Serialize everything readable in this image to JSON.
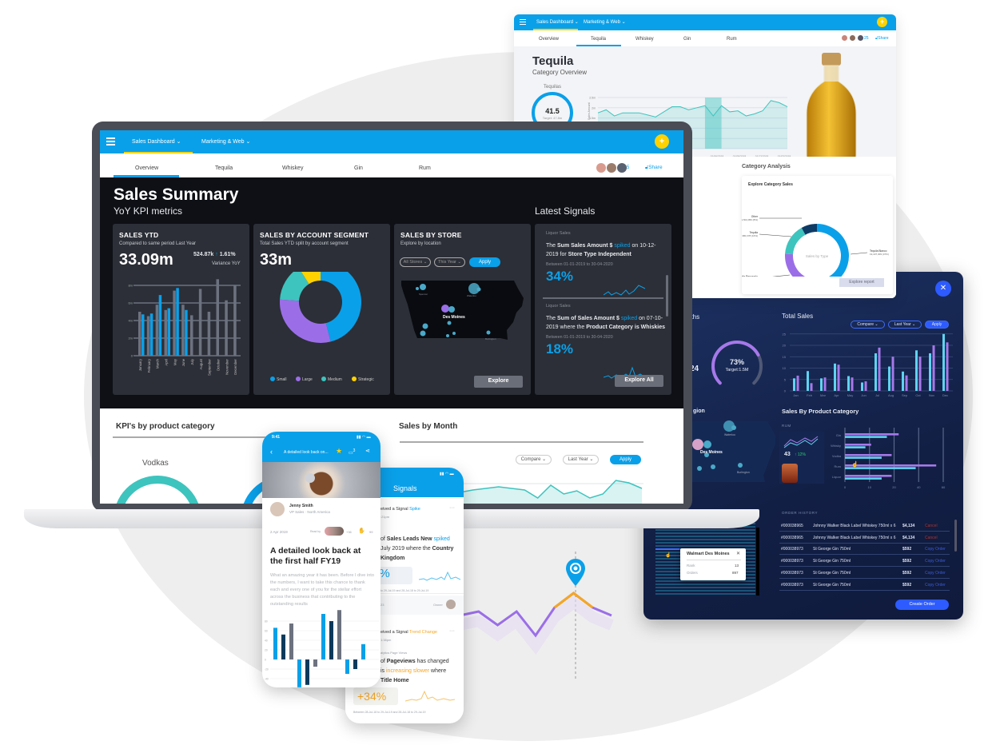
{
  "colors": {
    "brand_blue": "#0aa0e9",
    "accent_yellow": "#ffd200",
    "purple": "#9b6ee8",
    "teal": "#3dc4be",
    "navy_panel": "#16264f",
    "dark_screen": "#0e1016",
    "card_dark": "#2c2f37",
    "orange": "#f5a623",
    "apply_blue": "#2d5bff"
  },
  "tequila_window": {
    "nav": {
      "primary": "Sales Dashboard",
      "secondary": "Marketing & Web",
      "add_icon": "plus-icon",
      "menu_icon": "hamburger-icon"
    },
    "tabs": [
      "Overview",
      "Tequila",
      "Whiskey",
      "Gin",
      "Rum"
    ],
    "active_tab": "Tequila",
    "avatar_extra": "25",
    "share": "Share",
    "title": "Tequila",
    "subtitle": "Category Overview",
    "gauge": {
      "label": "Tequilas",
      "value": "41.5",
      "target": "Target: 47.8m"
    },
    "analysis_title": "Category Analysis",
    "analysis_card_title": "Explore Category Sales",
    "explore_button": "Explore report"
  },
  "dark_panel": {
    "close_icon": "close-icon",
    "partial_months": "nths",
    "partial_value": "24",
    "gauge": {
      "value": "73%",
      "target": "Target:1.5M",
      "fraction": 0.73
    },
    "partial_region": "gion",
    "map_cities": [
      "Waterloo",
      "Des Moines",
      "Burlington"
    ],
    "total_sales_title": "Total Sales",
    "compare": "Compare",
    "last_year": "Last Year",
    "apply": "Apply",
    "product_category_title": "Sales By Product Category",
    "rum_card": {
      "label": "RUM",
      "value": "43",
      "change": "12%"
    },
    "order_history_title": "ORDER HISTORY",
    "orders": [
      {
        "id": "#000038965",
        "item": "Johnny Walker Black Label Whiskey 750ml x 6",
        "amount": "$4,134",
        "action": "Cancel"
      },
      {
        "id": "#000038965",
        "item": "Johnny Walker Black Label Whiskey 750ml x 6",
        "amount": "$4,134",
        "action": "Cancel"
      },
      {
        "id": "#000038973",
        "item": "St George Gin 750ml",
        "amount": "$592",
        "action": "Copy Order"
      },
      {
        "id": "#000038973",
        "item": "St George Gin 750ml",
        "amount": "$592",
        "action": "Copy Order"
      },
      {
        "id": "#000038973",
        "item": "St George Gin 750ml",
        "amount": "$592",
        "action": "Copy Order"
      },
      {
        "id": "#000038973",
        "item": "St George Gin 750ml",
        "amount": "$592",
        "action": "Copy Order"
      }
    ],
    "create_order": "Create Order",
    "tooltip": {
      "title": "Walmart Des Moines",
      "rank_label": "Rank",
      "rank": "13",
      "orders_label": "Orders",
      "orders": "897"
    }
  },
  "laptop": {
    "nav": {
      "primary": "Sales Dashboard",
      "secondary": "Marketing & Web"
    },
    "tabs": [
      "Overview",
      "Tequila",
      "Whiskey",
      "Gin",
      "Rum"
    ],
    "active_tab": "Overview",
    "avatar_extra": "5",
    "share": "Share",
    "title": "Sales Summary",
    "subtitle": "YoY KPI metrics",
    "signals_title": "Latest Signals",
    "sales_ytd": {
      "title": "SALES YTD",
      "subtitle": "Compared to same period Last Year",
      "value": "33.09m",
      "variance": "524.87k",
      "variance_pct": "1.61%",
      "variance_label": "Variance YoY"
    },
    "segment": {
      "title": "SALES BY ACCOUNT SEGMENT",
      "subtitle": "Total Sales YTD split by account segment",
      "value": "33m"
    },
    "store": {
      "title": "SALES BY STORE",
      "subtitle": "Explore by location",
      "all_stores": "All Stores",
      "this_year": "This Year",
      "apply": "Apply",
      "cities": [
        "Spencer",
        "Waterloo",
        "Des Moines",
        "Burlington"
      ],
      "explore": "Explore"
    },
    "signals": [
      {
        "category": "Liquor Sales",
        "pre": "The ",
        "b1": "Sum Sales Amount $",
        "hl": " spiked",
        "mid": " on 10-12-2019 for ",
        "b2": "Store Type Independent",
        "range": "Between  01-01-2019 to 30-04-2020",
        "value": "34%"
      },
      {
        "category": "Liquor Sales",
        "pre": "The ",
        "b1": "Sum of Sales Amount $",
        "hl": " spiked",
        "mid": " on 07-10-2019 where the ",
        "b2": "Product Category is Whiskies",
        "range": "Between  01-01-2019 to 30-04-2020",
        "value": "18%"
      }
    ],
    "explore_all": "Explore All",
    "kpi_title": "KPI's by product category",
    "kpi_item": "Vodkas",
    "month_title": "Sales by Month",
    "compare": "Compare",
    "last_year": "Last Year",
    "apply": "Apply"
  },
  "phone_article": {
    "time": "9:41",
    "header_title": "A detailed look back on...",
    "comments": "3",
    "author": "Jenny Smith",
    "author_role": "VP Sales · North America",
    "date": "2 Apr 2019",
    "read_by": "Read by",
    "readers_extra": "+36",
    "claps": "99",
    "title": "A detailed look back at the first half FY19",
    "body": "What an amazing year it has been. Before I dive into the numbers, I want to take this chance to thank each and every one of you for the stellar effort across the business that contributing to the outstanding results"
  },
  "phone_signals": {
    "title": "Signals",
    "s1": {
      "head": "eived a Signal ",
      "type": "Spike",
      "time": ":21pm",
      "l1a": "of ",
      "l1b": "Sales Leads New",
      "l1c": " spiked",
      "l2a": "July 2019 where the ",
      "l2b": "Country",
      "l3": "Kingdom",
      "value": "3%",
      "range": "to 29-Jul-19 and 28-Jul-18 to 29-Jul-19",
      "footer_left": "23",
      "owner": "Owner"
    },
    "s2": {
      "head": "eived a Signal ",
      "type": "Trend Change",
      "time": "1:38pm",
      "category": "alytics Page Views",
      "l1a": "of ",
      "l1b": "Pageviews",
      "l1c": " has changed",
      "l2a": "is ",
      "l2b": "increasing slower",
      "l2c": " where",
      "l3": "Title Home",
      "value": "+34%",
      "range": "Between 28-Jul-18 to 29-Jul-19 and 28-Jul-18 to 29-Jul-19"
    }
  },
  "chart_data": [
    {
      "id": "sales_ytd",
      "type": "bar",
      "categories": [
        "January",
        "February",
        "March",
        "April",
        "May",
        "June",
        "July",
        "August",
        "September",
        "October",
        "November",
        "December"
      ],
      "yticks": [
        "0",
        "2m",
        "4m",
        "6m",
        "8m"
      ],
      "ylim": [
        0,
        9
      ],
      "grid": true,
      "series": [
        {
          "color": "#6d7280",
          "values": [
            5.0,
            4.5,
            5.8,
            5.2,
            7.4,
            5.8,
            4.6,
            7.6,
            5.0,
            8.7,
            6.3,
            8.0
          ]
        },
        {
          "color": "#0aa0e9",
          "values": [
            4.7,
            4.8,
            6.9,
            5.4,
            7.7,
            5.2,
            null,
            null,
            null,
            null,
            null,
            null
          ]
        }
      ]
    },
    {
      "id": "segment",
      "type": "pie",
      "labels": [
        "Small",
        "Large",
        "Medium",
        "Strategic"
      ],
      "values": [
        46,
        30,
        15,
        9
      ],
      "colors": [
        "#0aa0e9",
        "#9b6ee8",
        "#3dc4be",
        "#ffd200"
      ],
      "legend": "bottom"
    },
    {
      "id": "tequila_trend",
      "type": "area",
      "ylabel": "Sales Amount",
      "yticks": [
        "1m",
        "1.5m",
        "2m",
        "2.5m"
      ],
      "ylim": [
        0,
        2.5
      ],
      "xticks": [
        "01/06/2018",
        "01/09/2018",
        "01/12/2018",
        "01/03/2019"
      ],
      "values": [
        1.75,
        1.9,
        1.6,
        1.75,
        1.75,
        1.75,
        1.65,
        1.55,
        1.8,
        2.05,
        2.05,
        1.9,
        2.0,
        2.1,
        1.6,
        2.1,
        1.8,
        1.85,
        1.6,
        1.7,
        1.85,
        2.35,
        2.25,
        2.05
      ],
      "highlight": [
        13,
        15
      ],
      "color": "#3dc4be"
    },
    {
      "id": "category_sales",
      "type": "pie",
      "center_label": "Sales by Type",
      "labels": [
        "Tequila Blanco",
        "Tequila Reposado",
        "Tequila",
        "Other"
      ],
      "label_values": [
        "19,437,309 (47%)",
        "12,459,063 (29%)",
        "6,380,378 (16%)",
        "1,504,956 (8%)"
      ],
      "values": [
        47,
        29,
        16,
        8
      ],
      "colors": [
        "#0aa0e9",
        "#9b6ee8",
        "#3dc4be",
        "#0d3b66"
      ]
    },
    {
      "id": "total_sales",
      "type": "bar",
      "categories": [
        "Jan",
        "Feb",
        "Mar",
        "Apr",
        "May",
        "Jun",
        "Jul",
        "Aug",
        "Sep",
        "Oct",
        "Nov",
        "Dec"
      ],
      "yticks": [
        "0",
        "5",
        "10",
        "15",
        "20",
        "25"
      ],
      "ylim": [
        0,
        25
      ],
      "grid": true,
      "series": [
        {
          "color": "#5fd3f0",
          "values": [
            5.5,
            8.7,
            5.5,
            12,
            6.5,
            3.7,
            16.5,
            10.7,
            8.5,
            17.8,
            16.5,
            25
          ]
        },
        {
          "color": "#a678ea",
          "values": [
            6.7,
            3.4,
            5.9,
            11.5,
            5.9,
            4.2,
            19,
            15,
            6.8,
            15,
            20,
            21.3
          ]
        }
      ]
    },
    {
      "id": "product_category",
      "type": "bar",
      "orientation": "horizontal",
      "categories": [
        "Gin",
        "Whisky",
        "Vodka",
        "Rum",
        "Liquor"
      ],
      "xticks": [
        "0",
        "10",
        "20",
        "40",
        "60"
      ],
      "xlim": [
        0,
        60
      ],
      "series": [
        {
          "color": "#a678ea",
          "values": [
            32.8,
            16,
            28.5,
            55.7,
            28.5
          ]
        },
        {
          "color": "#5fd3f0",
          "values": [
            25.6,
            12.5,
            22.4,
            43.2,
            22.4
          ]
        }
      ]
    },
    {
      "id": "article_chart",
      "type": "bar",
      "yticks": [
        "80",
        "60",
        "40",
        "20",
        "0",
        "-20",
        "-40"
      ],
      "ylim": [
        -40,
        100
      ],
      "values": [
        66,
        52,
        75,
        -58,
        -53,
        -15,
        95,
        80,
        103,
        -30,
        -20,
        32
      ],
      "colors": [
        "#0aa0e9",
        "#0b3a5c",
        "#6d7280",
        "#0aa0e9",
        "#0b3a5c",
        "#6d7280",
        "#0aa0e9",
        "#0b3a5c",
        "#6d7280",
        "#0aa0e9",
        "#0b3a5c",
        "#0aa0e9"
      ]
    },
    {
      "id": "sales_by_month",
      "type": "area",
      "values": [
        15,
        18,
        20,
        22,
        20,
        18,
        8,
        24,
        13,
        17,
        8,
        13,
        30,
        27,
        20
      ],
      "color": "#3dc4be"
    },
    {
      "id": "trend_line",
      "type": "line",
      "values": [
        80,
        85,
        68,
        85,
        55,
        90,
        108,
        90,
        80
      ],
      "highlight": [
        5,
        7
      ],
      "colors": [
        "#9b6ee8",
        "#f5a623"
      ]
    }
  ]
}
